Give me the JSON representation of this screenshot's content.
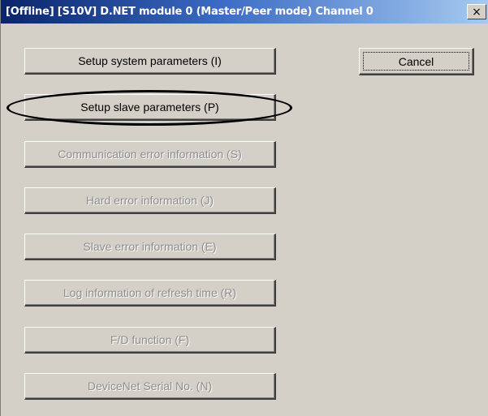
{
  "window": {
    "title": "[Offline] [S10V] D.NET module 0 (Master/Peer mode) Channel 0",
    "close_glyph": "×"
  },
  "buttons": [
    {
      "label": "Setup system parameters (I)",
      "enabled": true
    },
    {
      "label": "Setup slave parameters (P)",
      "enabled": true,
      "highlighted": true
    },
    {
      "label": "Communication error information (S)",
      "enabled": false
    },
    {
      "label": "Hard error information (J)",
      "enabled": false
    },
    {
      "label": "Slave error information (E)",
      "enabled": false
    },
    {
      "label": "Log information of refresh time (R)",
      "enabled": false
    },
    {
      "label": "F/D function (F)",
      "enabled": false
    },
    {
      "label": "DeviceNet Serial No. (N)",
      "enabled": false
    }
  ],
  "cancel": {
    "label": "Cancel",
    "focused": true
  },
  "colors": {
    "highlight_ring": "#000000",
    "disabled_text": "#8e8e8e",
    "face": "#d4d0c8"
  }
}
